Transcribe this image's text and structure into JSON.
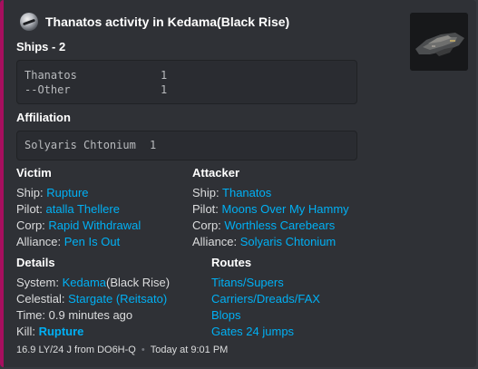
{
  "author": {
    "name": "Thanatos activity in Kedama(Black Rise)",
    "icon": "eve-corp-logo-icon"
  },
  "thumbnail": {
    "icon": "thanatos-ship-render-icon"
  },
  "ships": {
    "title": "Ships - 2",
    "rows": [
      {
        "name": "Thanatos",
        "count": "1"
      },
      {
        "name": "--Other",
        "count": "1"
      }
    ]
  },
  "affiliation": {
    "title": "Affiliation",
    "rows": [
      {
        "name": "Solyaris Chtonium",
        "count": "1"
      }
    ]
  },
  "victim": {
    "title": "Victim",
    "ship_label": "Ship:",
    "ship": "Rupture",
    "pilot_label": "Pilot:",
    "pilot": "atalla Thellere",
    "corp_label": "Corp:",
    "corp": "Rapid Withdrawal",
    "alliance_label": "Alliance:",
    "alliance": "Pen Is Out"
  },
  "attacker": {
    "title": "Attacker",
    "ship_label": "Ship:",
    "ship": "Thanatos",
    "pilot_label": "Pilot:",
    "pilot": "Moons Over My Hammy",
    "corp_label": "Corp:",
    "corp": "Worthless Carebears",
    "alliance_label": "Alliance:",
    "alliance": "Solyaris Chtonium"
  },
  "details": {
    "title": "Details",
    "system_label": "System:",
    "system": "Kedama",
    "system_region": "(Black Rise)",
    "celestial_label": "Celestial:",
    "celestial": "Stargate (Reitsato)",
    "time": "Time: 0.9 minutes ago",
    "kill_label": "Kill:",
    "kill": "Rupture"
  },
  "routes": {
    "title": "Routes",
    "items": [
      "Titans/Supers",
      "Carriers/Dreads/FAX",
      "Blops",
      "Gates 24 jumps"
    ]
  },
  "footer": {
    "distance": "16.9 LY/24 J from DO6H-Q",
    "timestamp": "Today at 9:01 PM"
  },
  "colors": {
    "accent": "#a70f5e",
    "link": "#00b0f4",
    "embed_bg": "#2f3136",
    "page_bg": "#36393f"
  }
}
